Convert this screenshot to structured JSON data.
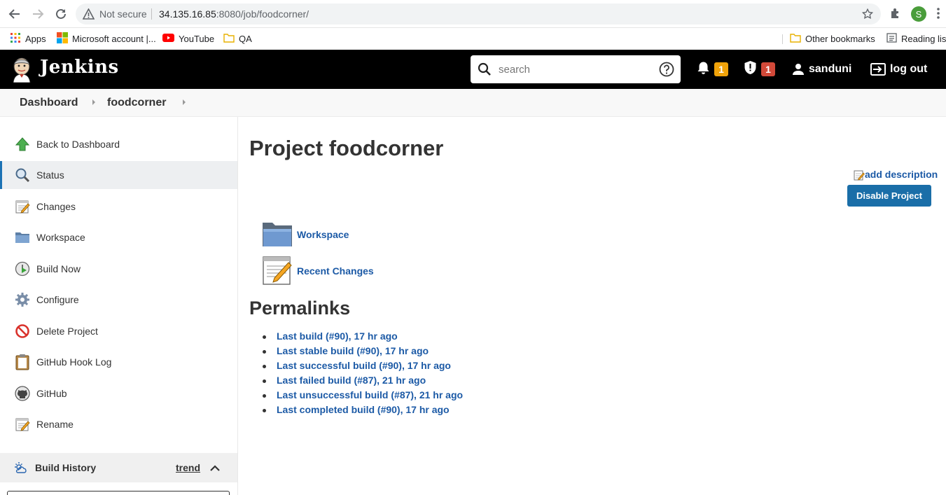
{
  "browser": {
    "security_label": "Not secure",
    "url_host": "34.135.16.85",
    "url_path": ":8080/job/foodcorner/",
    "avatar_letter": "S",
    "bookmarks": [
      {
        "label": "Apps",
        "icon": "apps-grid-icon"
      },
      {
        "label": "Microsoft account |...",
        "icon": "microsoft-icon"
      },
      {
        "label": "YouTube",
        "icon": "youtube-icon"
      },
      {
        "label": "QA",
        "icon": "folder-icon"
      }
    ],
    "other_bookmarks": "Other bookmarks",
    "reading_list": "Reading list"
  },
  "header": {
    "title": "Jenkins",
    "search_placeholder": "search",
    "notifications_count": "1",
    "security_count": "1",
    "user": "sanduni",
    "logout": "log out",
    "colors": {
      "bar": "#000000",
      "notify_badge": "#f0a30a",
      "security_badge": "#d24939"
    }
  },
  "breadcrumbs": [
    "Dashboard",
    "foodcorner"
  ],
  "sidebar": {
    "tasks": [
      {
        "label": "Back to Dashboard",
        "icon": "up-arrow-icon"
      },
      {
        "label": "Status",
        "icon": "magnifier-icon",
        "active": true
      },
      {
        "label": "Changes",
        "icon": "notepad-icon"
      },
      {
        "label": "Workspace",
        "icon": "folder-icon"
      },
      {
        "label": "Build Now",
        "icon": "clock-play-icon"
      },
      {
        "label": "Configure",
        "icon": "gear-icon"
      },
      {
        "label": "Delete Project",
        "icon": "no-entry-icon"
      },
      {
        "label": "GitHub Hook Log",
        "icon": "clipboard-icon"
      },
      {
        "label": "GitHub",
        "icon": "github-icon"
      },
      {
        "label": "Rename",
        "icon": "notepad-icon"
      }
    ],
    "build_history": {
      "title": "Build History",
      "trend": "trend"
    }
  },
  "main": {
    "title": "Project foodcorner",
    "add_description": "add description",
    "disable_button": "Disable Project",
    "links": [
      {
        "label": "Workspace",
        "icon": "folder-icon"
      },
      {
        "label": "Recent Changes",
        "icon": "notepad-icon"
      }
    ],
    "permalinks_title": "Permalinks",
    "permalinks": [
      "Last build (#90), 17 hr ago",
      "Last stable build (#90), 17 hr ago",
      "Last successful build (#90), 17 hr ago",
      "Last failed build (#87), 21 hr ago",
      "Last unsuccessful build (#87), 21 hr ago",
      "Last completed build (#90), 17 hr ago"
    ],
    "link_color": "#1c5aa6",
    "button_color": "#1a6ea8"
  }
}
